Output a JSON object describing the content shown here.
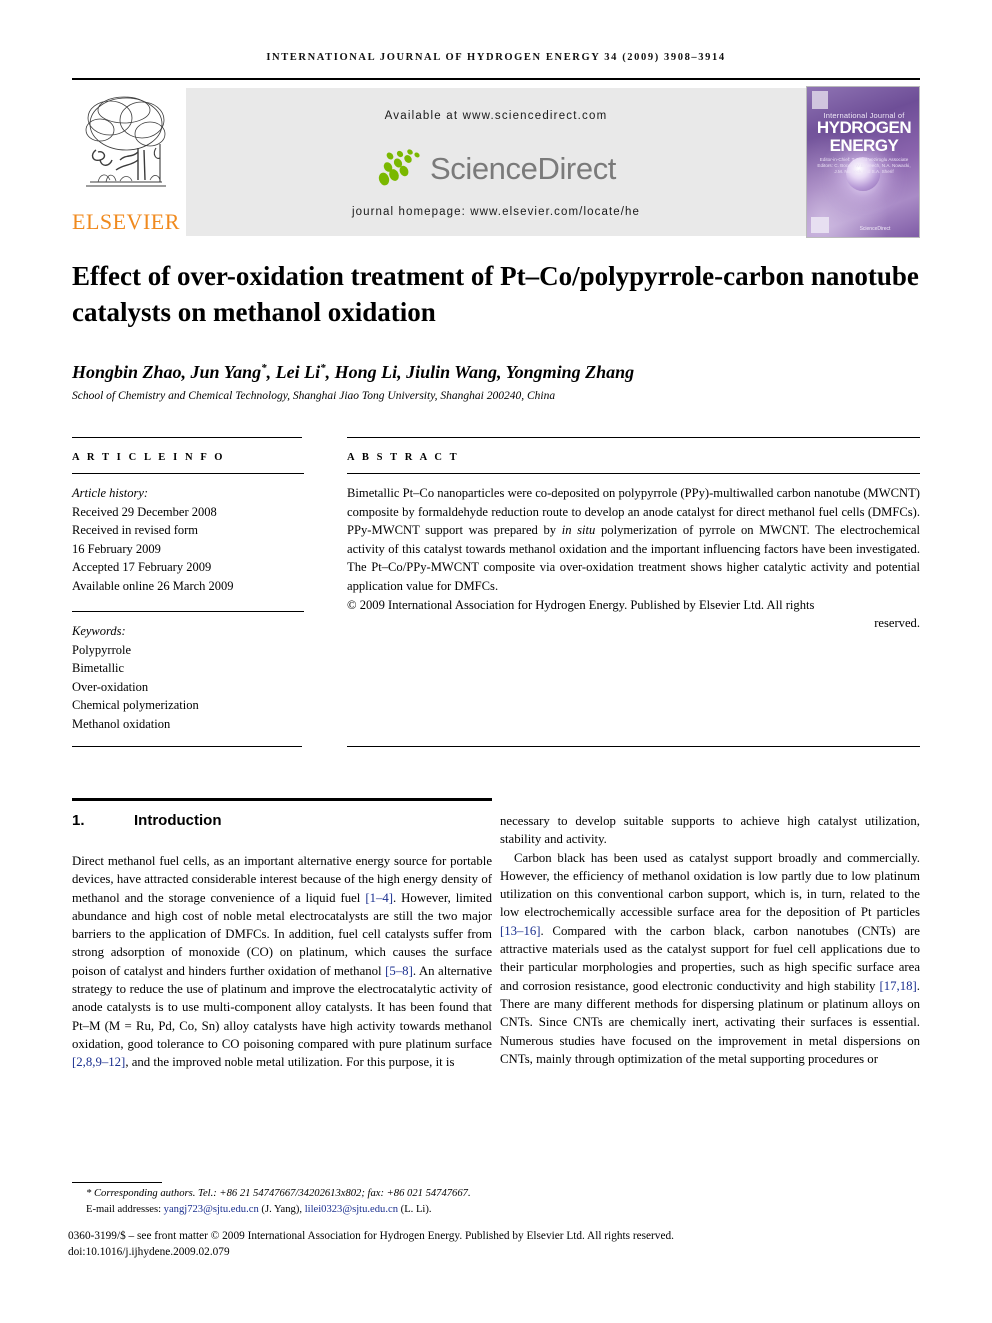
{
  "running_head": "INTERNATIONAL JOURNAL OF HYDROGEN ENERGY 34 (2009) 3908–3914",
  "banner": {
    "publisher_name": "ELSEVIER",
    "publisher_logo_alt": "elsevier-tree-logo",
    "available_at": "Available at www.sciencedirect.com",
    "sciencedirect_word": "ScienceDirect",
    "journal_homepage": "journal homepage: www.elsevier.com/locate/he",
    "cover": {
      "line1": "International Journal of",
      "line2": "HYDROGEN",
      "line3": "ENERGY",
      "editors": "Editor-in-Chief: T. Nejat Veziroglu  Associate Editors: C. Bocek, W.E. Veech, N.A. Nowacki, J.M. Norbeck and S.A. Sherif",
      "footer_mark": "ScienceDirect"
    },
    "colors": {
      "elsevier_orange": "#F08A1E",
      "sciencedirect_green": "#7AB800",
      "sciencedirect_gray": "#7A7A7A",
      "panel_gray": "#E9E9E9",
      "cover_purple": "#6C4F8F"
    }
  },
  "article": {
    "title": "Effect of over-oxidation treatment of Pt–Co/polypyrrole-carbon nanotube catalysts on methanol oxidation",
    "authors_html": "Hongbin Zhao, Jun Yang<sup>*</sup>, Lei Li<sup>*</sup>, Hong Li, Jiulin Wang, Yongming Zhang",
    "affiliation": "School of Chemistry and Chemical Technology, Shanghai Jiao Tong University, Shanghai 200240, China"
  },
  "article_info": {
    "heading": "A R T I C L E  I N F O",
    "history_label": "Article history:",
    "history": [
      "Received 29 December 2008",
      "Received in revised form",
      "16 February 2009",
      "Accepted 17 February 2009",
      "Available online 26 March 2009"
    ],
    "keywords_label": "Keywords:",
    "keywords": [
      "Polypyrrole",
      "Bimetallic",
      "Over-oxidation",
      "Chemical polymerization",
      "Methanol oxidation"
    ]
  },
  "abstract": {
    "heading": "A B S T R A C T",
    "part1": "Bimetallic Pt–Co nanoparticles were co-deposited on polypyrrole (PPy)-multiwalled carbon nanotube (MWCNT) composite by formaldehyde reduction route to develop an anode catalyst for direct methanol fuel cells (DMFCs). PPy-MWCNT support was prepared by ",
    "in_situ": "in situ",
    "part2": " polymerization of pyrrole on MWCNT. The electrochemical activity of this catalyst towards methanol oxidation and the important influencing factors have been investigated. The Pt–Co/PPy-MWCNT composite via over-oxidation treatment shows higher catalytic activity and potential application value for DMFCs.",
    "copyright": "© 2009 International Association for Hydrogen Energy. Published by Elsevier Ltd. All rights",
    "copyright_last": "reserved."
  },
  "section": {
    "number": "1.",
    "title": "Introduction"
  },
  "body": {
    "left_col": {
      "p1_a": "Direct methanol fuel cells, as an important alternative energy source for portable devices, have attracted considerable interest because of the high energy density of methanol and the storage convenience of a liquid fuel ",
      "ref1": "[1–4]",
      "p1_b": ". However, limited abundance and high cost of noble metal electrocatalysts are still the two major barriers to the application of DMFCs. In addition, fuel cell catalysts suffer from strong adsorption of monoxide (CO) on platinum, which causes the surface poison of catalyst and hinders further oxidation of methanol ",
      "ref2": "[5–8]",
      "p1_c": ". An alternative strategy to reduce the use of platinum and improve the electrocatalytic activity of anode catalysts is to use multi-component alloy catalysts. It has been found that Pt–M (M = Ru, Pd, Co, Sn) alloy catalysts have high activity towards methanol oxidation, good tolerance to CO poisoning compared with pure platinum surface ",
      "ref3": "[2,8,9–12]",
      "p1_d": ", and the improved noble metal utilization. For this purpose, it is"
    },
    "right_col": {
      "p1": "necessary to develop suitable supports to achieve high catalyst utilization, stability and activity.",
      "p2_a": "Carbon black has been used as catalyst support broadly and commercially. However, the efficiency of methanol oxidation is low partly due to low platinum utilization on this conventional carbon support, which is, in turn, related to the low electrochemically accessible surface area for the deposition of Pt particles ",
      "ref1": "[13–16]",
      "p2_b": ". Compared with the carbon black, carbon nanotubes (CNTs) are attractive materials used as the catalyst support for fuel cell applications due to their particular morphologies and properties, such as high specific surface area and corrosion resistance, good electronic conductivity and high stability ",
      "ref2": "[17,18]",
      "p2_c": ". There are many different methods for dispersing platinum or platinum alloys on CNTs. Since CNTs are chemically inert, activating their surfaces is essential. Numerous studies have focused on the improvement in metal dispersions on CNTs, mainly through optimization of the metal supporting procedures or"
    }
  },
  "footer": {
    "corresponding_marker": "*",
    "corresponding_text": "Corresponding authors. Tel.: +86 21 54747667/34202613x802; fax: +86 021 54747667.",
    "email_label": "E-mail addresses: ",
    "email1": "yangj723@sjtu.edu.cn",
    "email1_owner": " (J. Yang), ",
    "email2": "lilei0323@sjtu.edu.cn",
    "email2_owner": " (L. Li).",
    "issn_line": "0360-3199/$ – see front matter © 2009 International Association for Hydrogen Energy. Published by Elsevier Ltd. All rights reserved.",
    "doi_line": "doi:10.1016/j.ijhydene.2009.02.079"
  }
}
